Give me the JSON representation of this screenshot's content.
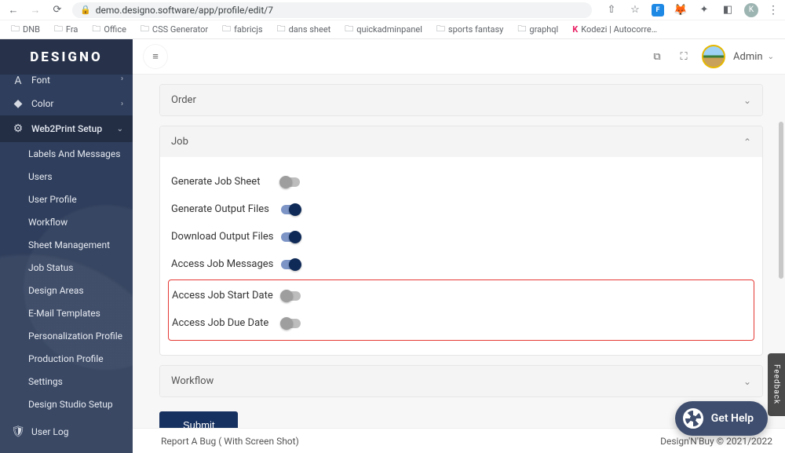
{
  "browser": {
    "url": "demo.designo.software/app/profile/edit/7",
    "bookmarks": [
      "DNB",
      "Fra",
      "Office",
      "CSS Generator",
      "fabricjs",
      "dans sheet",
      "quickadminpanel",
      "sports fantasy",
      "graphql"
    ],
    "kodezi": "Kodezi | Autocorre…"
  },
  "brand": "DESIGNO",
  "sidebar": {
    "cut": {
      "icon": "A",
      "label": "Font"
    },
    "color": {
      "icon": "◆",
      "label": "Color"
    },
    "section": {
      "icon": "⚙",
      "label": "Web2Print Setup"
    },
    "subs": [
      "Labels And Messages",
      "Users",
      "User Profile",
      "Workflow",
      "Sheet Management",
      "Job Status",
      "Design Areas",
      "E-Mail Templates",
      "Personalization Profile",
      "Production Profile",
      "Settings",
      "Design Studio Setup"
    ],
    "userlog": {
      "icon": "🛡",
      "label": "User Log"
    }
  },
  "topbar": {
    "user": "Admin"
  },
  "panels": {
    "order": "Order",
    "job": "Job",
    "workflow": "Workflow"
  },
  "job_rows": {
    "gen_sheet": "Generate Job Sheet",
    "gen_output": "Generate Output Files",
    "dl_output": "Download Output Files",
    "access_msgs": "Access Job Messages",
    "start_date": "Access Job Start Date",
    "due_date": "Access Job Due Date"
  },
  "buttons": {
    "submit": "Submit"
  },
  "footer": {
    "left": "Report A Bug ( With Screen Shot)",
    "right": "Design'N'Buy © 2021/2022"
  },
  "widgets": {
    "feedback": "Feedback",
    "gethelp": "Get Help"
  }
}
